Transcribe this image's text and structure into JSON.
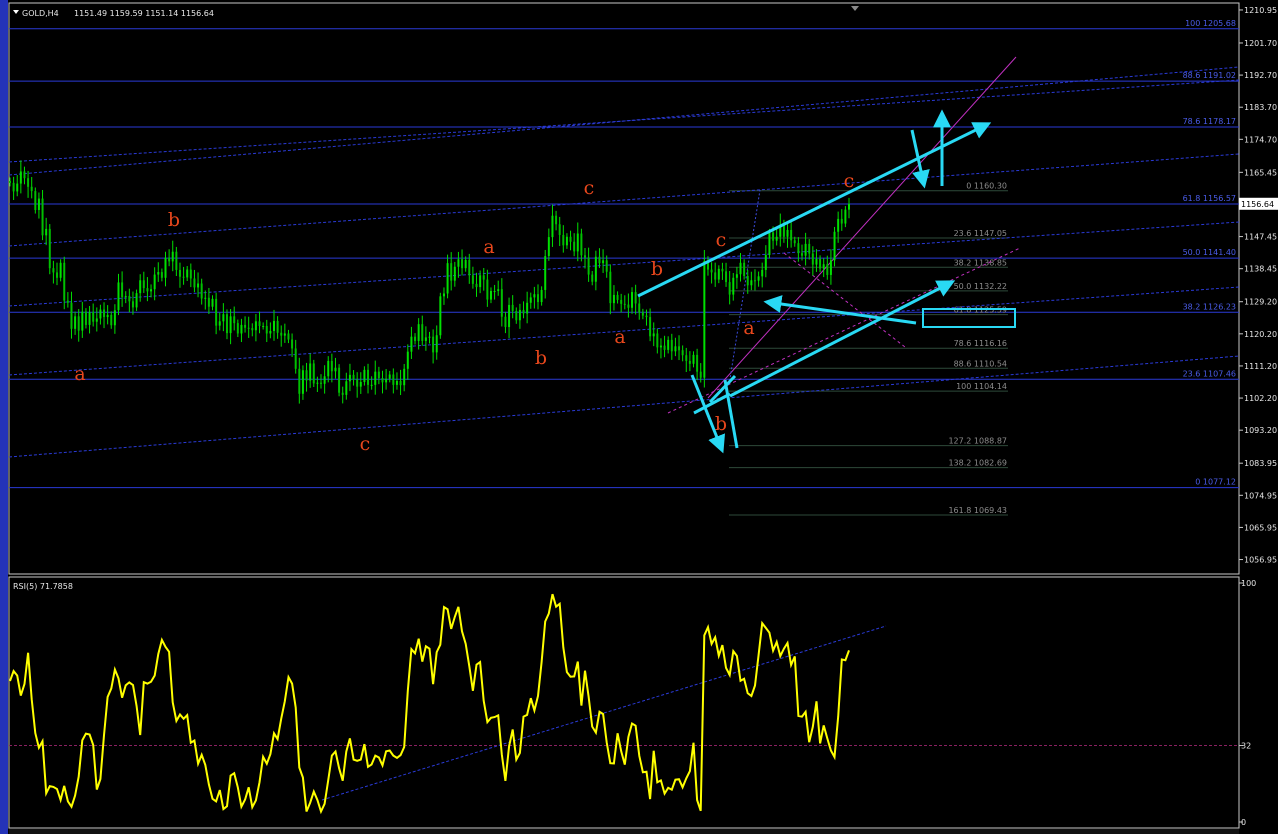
{
  "header": {
    "symbol_label": "GOLD,H4",
    "ohlc": "1151.49 1159.59 1151.14 1156.64"
  },
  "price_axis": {
    "ticks": [
      "1210.95",
      "1201.70",
      "1192.70",
      "1183.70",
      "1174.70",
      "1165.45",
      "1156.45",
      "1147.45",
      "1138.45",
      "1129.20",
      "1120.20",
      "1111.20",
      "1102.20",
      "1093.20",
      "1083.95",
      "1074.95",
      "1065.95",
      "1056.95"
    ],
    "current_price": "1156.64"
  },
  "rsi_panel": {
    "label": "RSI(5) 71.7858",
    "ticks": [
      "100",
      "32",
      "0"
    ]
  },
  "colors": {
    "background": "#000000",
    "candle_up": "#00e000",
    "candle_down": "#00c000",
    "fib_levels": "#2a3ad6",
    "annotation_cyan": "#29d9f4",
    "trendline_magenta": "#c030c0",
    "rsi_line": "#ffff00",
    "wave_label": "#e8471c"
  },
  "chart_data": [
    {
      "type": "candlestick",
      "title": "GOLD,H4",
      "ylim": [
        1052.9,
        1212.9
      ],
      "series": [
        {
          "name": "GOLD,H4",
          "close": [
            1162.5,
            1160.1,
            1162.3,
            1165.7,
            1163.8,
            1161.4,
            1160.2,
            1154.9,
            1158.1,
            1147.8,
            1149.6,
            1138.6,
            1137.4,
            1135.9,
            1140.1,
            1129.5,
            1128.9,
            1121.6,
            1125.1,
            1121.1,
            1126.4,
            1122.7,
            1126.3,
            1123.6,
            1124.5,
            1127.0,
            1124.9,
            1125.5,
            1122.6,
            1126.8,
            1134.6,
            1130.5,
            1130.8,
            1129.3,
            1127.6,
            1131.6,
            1135.2,
            1133.0,
            1132.1,
            1132.7,
            1136.8,
            1137.5,
            1135.9,
            1141.5,
            1140.5,
            1143.2,
            1138.1,
            1136.2,
            1136.0,
            1138.2,
            1135.7,
            1133.2,
            1134.3,
            1130.1,
            1130.3,
            1127.8,
            1130.0,
            1122.5,
            1123.7,
            1125.7,
            1120.4,
            1125.1,
            1123.2,
            1120.3,
            1122.7,
            1121.9,
            1121.8,
            1121.2,
            1123.7,
            1122.4,
            1122.4,
            1120.3,
            1121.0,
            1123.8,
            1120.5,
            1119.7,
            1120.3,
            1118.6,
            1116.1,
            1110.4,
            1103.4,
            1110.0,
            1107.1,
            1111.9,
            1106.3,
            1106.5,
            1106.2,
            1108.3,
            1112.6,
            1109.7,
            1110.7,
            1103.7,
            1103.1,
            1106.9,
            1108.7,
            1107.4,
            1105.4,
            1106.7,
            1110.1,
            1105.9,
            1105.9,
            1109.6,
            1107.8,
            1106.6,
            1107.6,
            1108.8,
            1105.9,
            1107.0,
            1105.8,
            1110.4,
            1115.2,
            1119.4,
            1118.2,
            1122.9,
            1118.2,
            1119.2,
            1119.4,
            1115.0,
            1119.8,
            1130.7,
            1131.5,
            1140.0,
            1135.1,
            1139.0,
            1141.1,
            1138.6,
            1140.9,
            1136.6,
            1134.2,
            1133.3,
            1136.6,
            1135.4,
            1129.8,
            1132.2,
            1132.2,
            1132.7,
            1125.0,
            1122.1,
            1128.3,
            1126.6,
            1124.0,
            1126.9,
            1125.9,
            1128.9,
            1130.4,
            1131.3,
            1129.1,
            1132.5,
            1142.0,
            1147.3,
            1153.3,
            1150.9,
            1147.9,
            1145.0,
            1147.4,
            1146.0,
            1143.3,
            1148.3,
            1142.2,
            1141.6,
            1136.8,
            1134.8,
            1141.8,
            1140.0,
            1140.8,
            1137.6,
            1128.8,
            1131.1,
            1129.7,
            1128.6,
            1128.4,
            1127.5,
            1131.9,
            1128.7,
            1126.2,
            1125.3,
            1124.9,
            1119.5,
            1120.3,
            1116.4,
            1116.9,
            1115.7,
            1118.5,
            1115.3,
            1116.7,
            1115.6,
            1114.2,
            1112.6,
            1111.8,
            1114.3,
            1109.6,
            1107.9,
            1140.6,
            1138.2,
            1137.4,
            1135.4,
            1138.4,
            1137.7,
            1134.7,
            1131.2,
            1135.9,
            1136.9,
            1140.1,
            1136.4,
            1133.8,
            1135.2,
            1135.1,
            1136.3,
            1138.1,
            1142.3,
            1148.6,
            1146.3,
            1147.4,
            1150.8,
            1147.4,
            1149.3,
            1146.4,
            1145.6,
            1142.8,
            1142.1,
            1145.4,
            1142.7,
            1139.6,
            1141.2,
            1138.5,
            1139.7,
            1136.7,
            1140.8,
            1148.8,
            1152.4,
            1151.1,
            1155.0,
            1156.6
          ]
        }
      ],
      "fibonacci_levels": [
        {
          "label": "100",
          "price": "1205.68"
        },
        {
          "label": "88.6",
          "price": "1191.02"
        },
        {
          "label": "78.6",
          "price": "1178.17"
        },
        {
          "label": "61.8",
          "price": "1156.57"
        },
        {
          "label": "50.0",
          "price": "1141.40"
        },
        {
          "label": "38.2",
          "price": "1126.23"
        },
        {
          "label": "23.6",
          "price": "1107.46"
        },
        {
          "label": "0",
          "price": "1077.12"
        }
      ],
      "fibonacci_short_levels": [
        {
          "label": "0",
          "price": "1160.30"
        },
        {
          "label": "23.6",
          "price": "1147.05"
        },
        {
          "label": "38.2",
          "price": "1138.85"
        },
        {
          "label": "50.0",
          "price": "1132.22"
        },
        {
          "label": "61.8",
          "price": "1125.59"
        },
        {
          "label": "78.6",
          "price": "1116.16"
        },
        {
          "label": "88.6",
          "price": "1110.54"
        },
        {
          "label": "100",
          "price": "1104.14"
        },
        {
          "label": "127.2",
          "price": "1088.87"
        },
        {
          "label": "138.2",
          "price": "1082.69"
        },
        {
          "label": "161.8",
          "price": "1069.43"
        }
      ],
      "wave_labels": [
        "a",
        "b",
        "c",
        "a",
        "b",
        "c",
        "a",
        "b",
        "c",
        "a",
        "b",
        "c"
      ]
    },
    {
      "type": "line",
      "title": "RSI(5) 71.7858",
      "ylim": [
        0,
        100
      ],
      "reference_line": 32,
      "series": [
        {
          "name": "RSI(5)",
          "values": [
            59.0,
            63.2,
            61.3,
            52.9,
            57.8,
            70.8,
            51.4,
            37.2,
            31.1,
            33.8,
            12.0,
            15.0,
            14.7,
            13.8,
            9.2,
            15.1,
            8.6,
            6.4,
            11.1,
            19.0,
            34.2,
            37.0,
            36.6,
            32.2,
            13.6,
            18.0,
            36.3,
            52.3,
            55.9,
            63.8,
            60.1,
            52.0,
            57.2,
            58.4,
            57.3,
            48.5,
            36.4,
            58.5,
            57.9,
            58.7,
            61.3,
            70.3,
            76.2,
            73.3,
            71.2,
            50.1,
            42.3,
            45.0,
            43.2,
            44.7,
            33.2,
            34.1,
            24.4,
            28.1,
            23.9,
            15.7,
            9.7,
            8.6,
            13.4,
            5.4,
            6.6,
            19.4,
            20.4,
            14.5,
            6.4,
            9.4,
            14.5,
            6.2,
            9.1,
            16.6,
            27.3,
            24.4,
            28.4,
            37.1,
            34.7,
            43.2,
            50.5,
            60.6,
            57.9,
            47.9,
            22.8,
            18.6,
            4.4,
            8.1,
            12.7,
            9.2,
            4.4,
            7.6,
            17.4,
            27.8,
            29.5,
            22.5,
            17.3,
            29.5,
            35.0,
            26.1,
            25.6,
            26.1,
            32.6,
            23.1,
            24.1,
            27.8,
            27.0,
            23.7,
            29.6,
            29.9,
            27.8,
            26.8,
            28.0,
            31.4,
            54.9,
            72.3,
            70.6,
            76.7,
            67.1,
            73.5,
            72.5,
            57.7,
            71.1,
            74.2,
            89.9,
            89.0,
            80.8,
            85.8,
            90.0,
            79.8,
            74.5,
            65.2,
            54.9,
            65.8,
            66.9,
            50.7,
            41.8,
            43.6,
            43.9,
            44.6,
            28.3,
            17.2,
            31.7,
            38.7,
            26.1,
            28.9,
            44.1,
            44.8,
            51.8,
            46.7,
            52.7,
            66.9,
            83.9,
            87.2,
            95.3,
            90.1,
            91.3,
            73.1,
            62.7,
            60.8,
            60.9,
            67.1,
            48.7,
            63.3,
            52.5,
            39.9,
            37.4,
            46.1,
            45.2,
            33.3,
            24.6,
            24.5,
            37.1,
            29.6,
            24.0,
            35.6,
            41.2,
            40.3,
            27.7,
            20.8,
            21.0,
            9.6,
            29.8,
            16.6,
            17.4,
            11.9,
            14.3,
            13.5,
            17.7,
            17.9,
            14.5,
            18.3,
            21.3,
            33.2,
            9.2,
            4.7,
            78.1,
            81.5,
            74.5,
            77.3,
            69.6,
            74.0,
            64.5,
            61.5,
            71.5,
            69.5,
            59.1,
            59.9,
            53.9,
            52.7,
            57.1,
            69.9,
            83.2,
            81.2,
            79.2,
            71.7,
            75.3,
            69.4,
            72.5,
            74.9,
            65.7,
            69.3,
            44.4,
            44.1,
            46.1,
            33.4,
            39.8,
            50.5,
            32.9,
            40.4,
            35.0,
            29.9,
            27.2,
            44.2,
            68.0,
            67.7,
            71.8
          ]
        }
      ]
    }
  ]
}
